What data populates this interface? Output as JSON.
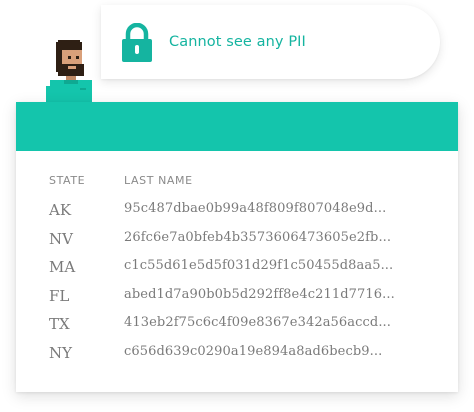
{
  "bubble": {
    "message": "Cannot see any PII",
    "accent_color": "#15b4a0",
    "icon": "lock-icon"
  },
  "avatar": {
    "icon": "pixel-person-avatar"
  },
  "card": {
    "header_color": "#14c5ac"
  },
  "table": {
    "columns": [
      "STATE",
      "LAST NAME"
    ],
    "rows": [
      {
        "state": "AK",
        "last_name": "95c487dbae0b99a48f809f807048e9d..."
      },
      {
        "state": "NV",
        "last_name": "26fc6e7a0bfeb4b3573606473605e2fb..."
      },
      {
        "state": "MA",
        "last_name": "c1c55d61e5d5f031d29f1c50455d8aa5..."
      },
      {
        "state": "FL",
        "last_name": "abed1d7a90b0b5d292ff8e4c211d7716..."
      },
      {
        "state": "TX",
        "last_name": "413eb2f75c6c4f09e8367e342a56accd..."
      },
      {
        "state": "NY",
        "last_name": "c656d639c0290a19e894a8ad6becb9..."
      }
    ]
  }
}
